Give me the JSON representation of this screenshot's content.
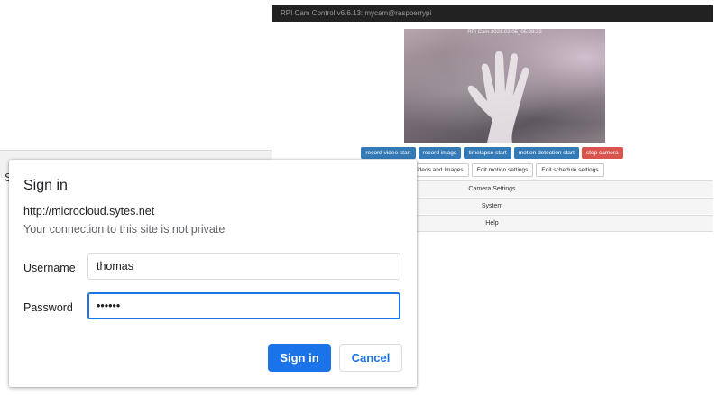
{
  "background": {
    "visible_letter": "S"
  },
  "cam": {
    "header_title": "RPI Cam Control v6.6.13: mycam@raspberrypi",
    "preview_timestamp": "RPi Cam  2021.02.05_05:29:23",
    "buttons_row1": [
      {
        "label": "record video start",
        "color": "#337ab7"
      },
      {
        "label": "record image",
        "color": "#337ab7"
      },
      {
        "label": "timelapse start",
        "color": "#337ab7"
      },
      {
        "label": "motion detection start",
        "color": "#337ab7"
      },
      {
        "label": "stop camera",
        "color": "#d9534f"
      }
    ],
    "buttons_row2": [
      {
        "label": "Download Videos and Images"
      },
      {
        "label": "Edit motion settings"
      },
      {
        "label": "Edit schedule settings"
      }
    ],
    "panels": [
      "Camera Settings",
      "System",
      "Help"
    ]
  },
  "dialog": {
    "title": "Sign in",
    "host": "http://microcloud.sytes.net",
    "warning": "Your connection to this site is not private",
    "username_label": "Username",
    "username_value": "thomas",
    "password_label": "Password",
    "password_value": "••••••",
    "signin_label": "Sign in",
    "cancel_label": "Cancel"
  },
  "colors": {
    "accent": "#1a73e8",
    "cam_header_bg": "#222222"
  }
}
